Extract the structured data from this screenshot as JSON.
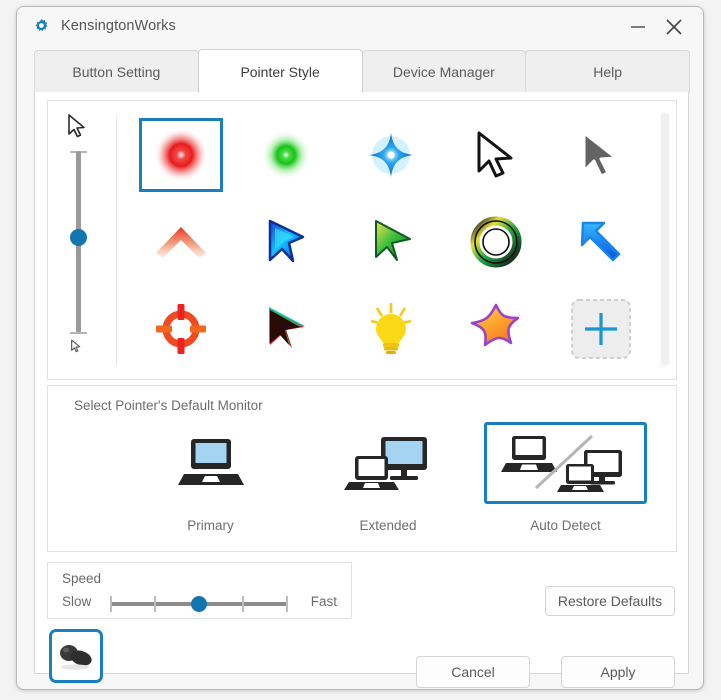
{
  "window": {
    "title": "KensingtonWorks",
    "icon": "gear-icon",
    "minimize_label": "–",
    "close_label": "×"
  },
  "tabs": [
    {
      "label": "Button Setting",
      "active": false
    },
    {
      "label": "Pointer Style",
      "active": true
    },
    {
      "label": "Device Manager",
      "active": false
    },
    {
      "label": "Help",
      "active": false
    }
  ],
  "pointer_panel": {
    "size_slider": {
      "big_icon": "large-cursor-icon",
      "small_icon": "small-cursor-icon",
      "value_percent": 50
    },
    "pointers": [
      {
        "name": "red-glow-pointer",
        "selected": true
      },
      {
        "name": "green-glow-pointer",
        "selected": false
      },
      {
        "name": "blue-sparkle-pointer",
        "selected": false
      },
      {
        "name": "white-arrow-pointer",
        "selected": false
      },
      {
        "name": "gray-arrow-pointer",
        "selected": false
      },
      {
        "name": "orange-chevron-pointer",
        "selected": false
      },
      {
        "name": "blue-outline-arrow-pointer",
        "selected": false
      },
      {
        "name": "green-gradient-arrow-pointer",
        "selected": false
      },
      {
        "name": "green-ring-pointer",
        "selected": false
      },
      {
        "name": "blue-up-left-arrow-pointer",
        "selected": false
      },
      {
        "name": "red-crosshair-pointer",
        "selected": false
      },
      {
        "name": "rainbow-arrow-pointer",
        "selected": false
      },
      {
        "name": "yellow-lightbulb-pointer",
        "selected": false
      },
      {
        "name": "orange-star-pointer",
        "selected": false
      },
      {
        "name": "add-custom-pointer",
        "selected": false
      }
    ]
  },
  "monitor_section": {
    "title": "Select Pointer's Default Monitor",
    "options": [
      {
        "label": "Primary",
        "icon": "single-laptop-icon",
        "selected": false
      },
      {
        "label": "Extended",
        "icon": "laptop-plus-monitor-icon",
        "selected": false
      },
      {
        "label": "Auto Detect",
        "icon": "auto-detect-monitors-icon",
        "selected": true
      }
    ]
  },
  "speed_section": {
    "title": "Speed",
    "min_label": "Slow",
    "max_label": "Fast",
    "value": 3,
    "steps": 5
  },
  "device": {
    "thumbnail_name": "trackball-device-thumbnail",
    "selected": true
  },
  "buttons": {
    "restore_defaults": "Restore Defaults",
    "cancel": "Cancel",
    "apply": "Apply"
  },
  "colors": {
    "accent": "#1a7fc1",
    "slider_thumb": "#1277b0",
    "text": "#5a5a5a",
    "panel_bg": "#ffffff"
  }
}
